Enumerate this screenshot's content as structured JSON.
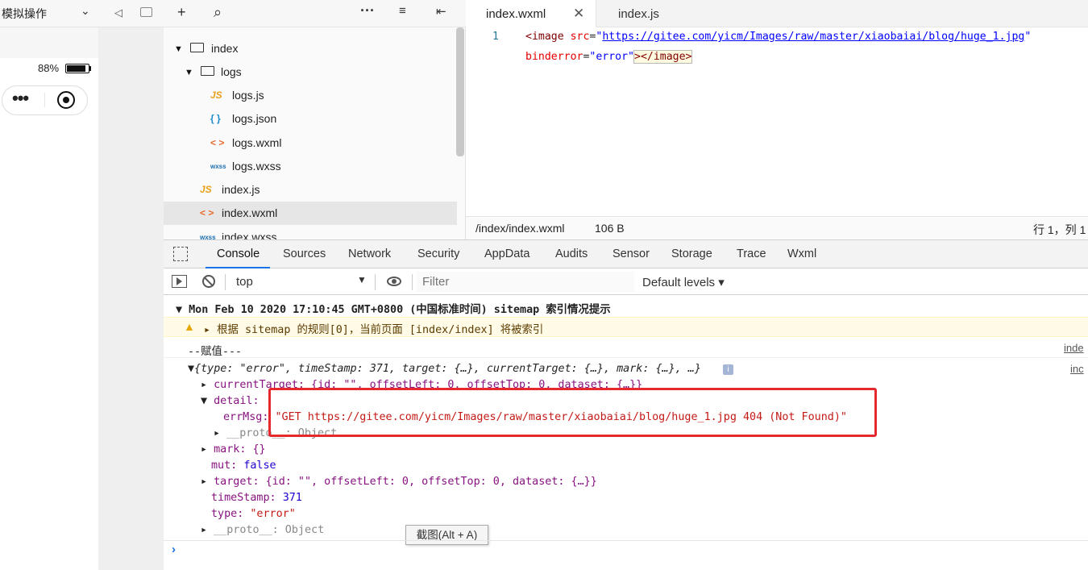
{
  "simulator": {
    "mode_label": "模拟操作",
    "battery_pct_label": "88%",
    "battery_level": 0.88
  },
  "file_tree": {
    "items": [
      {
        "label": "index",
        "icon": "folder-open-icon"
      },
      {
        "label": "logs",
        "icon": "folder-open-icon"
      },
      {
        "label": "logs.js",
        "icon": "js-file-icon",
        "icon_text": "JS"
      },
      {
        "label": "logs.json",
        "icon": "json-file-icon",
        "icon_text": "{ }"
      },
      {
        "label": "logs.wxml",
        "icon": "wxml-file-icon",
        "icon_text": "< >"
      },
      {
        "label": "logs.wxss",
        "icon": "wxss-file-icon",
        "icon_text": "wxss"
      },
      {
        "label": "index.js",
        "icon": "js-file-icon",
        "icon_text": "JS"
      },
      {
        "label": "index.wxml",
        "icon": "wxml-file-icon",
        "icon_text": "< >",
        "selected": true
      },
      {
        "label": "index.wxss",
        "icon": "wxss-file-icon",
        "icon_text": "wxss"
      }
    ]
  },
  "editor": {
    "tabs": [
      {
        "label": "index.wxml",
        "active": true
      },
      {
        "label": "index.js",
        "active": false
      }
    ],
    "line_number": "1",
    "code": {
      "open_tag": "<image",
      "src_attr": "src",
      "src_url": "https://gitee.com/yicm/Images/raw/master/xiaobaiai/blog/huge_1.jpg",
      "binderror_attr": "binderror",
      "binderror_value": "\"error\"",
      "close": "></image>"
    },
    "status": {
      "path": "/index/index.wxml",
      "size": "106 B",
      "position": "行 1，列 1"
    }
  },
  "devtools": {
    "tabs": [
      "Console",
      "Sources",
      "Network",
      "Security",
      "AppData",
      "Audits",
      "Sensor",
      "Storage",
      "Trace",
      "Wxml"
    ],
    "active_tab": "Console",
    "context": "top",
    "filter_placeholder": "Filter",
    "levels_label": "Default levels",
    "console": {
      "group_header": "Mon Feb 10 2020 17:10:45 GMT+0800 (中国标准时间) sitemap 索引情况提示",
      "warning": "根据 sitemap 的规则[0]，当前页面 [index/index] 将被索引",
      "log_fuzhi": "--赋值---",
      "source_link": "inde",
      "source_link2": "inc",
      "obj_summary": "{type: \"error\", timeStamp: 371, target: {…}, currentTarget: {…}, mark: {…}, …}",
      "current_target": "currentTarget: {id: \"\", offsetLeft: 0, offsetTop: 0, dataset: {…}}",
      "detail_key": "detail:",
      "errmsg_key": "errMsg:",
      "errmsg_value": "\"GET https://gitee.com/yicm/Images/raw/master/xiaobaiai/blog/huge_1.jpg 404 (Not Found)\"",
      "proto_detail": "__proto__: Object",
      "mark": "mark: {}",
      "mut_key": "mut:",
      "mut_value": "false",
      "target": "target: {id: \"\", offsetLeft: 0, offsetTop: 0, dataset: {…}}",
      "timestamp_key": "timeStamp:",
      "timestamp_value": "371",
      "type_key": "type:",
      "type_value": "\"error\"",
      "proto": "__proto__: Object"
    },
    "screenshot_tooltip": "截图(Alt + A)",
    "highlight_color": "#e5292f"
  }
}
